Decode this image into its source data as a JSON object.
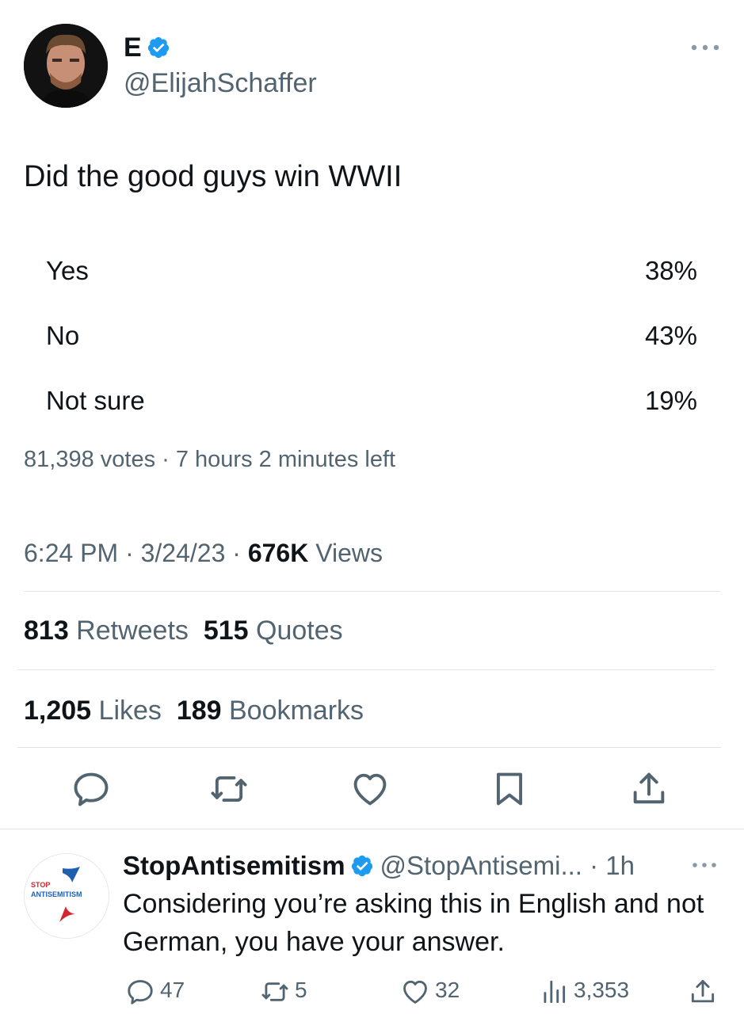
{
  "tweet": {
    "author_name": "E",
    "author_handle": "@ElijahSchaffer",
    "text": "Did the good guys win WWII",
    "poll": {
      "options": [
        {
          "label": "Yes",
          "percent": "38%"
        },
        {
          "label": "No",
          "percent": "43%"
        },
        {
          "label": "Not sure",
          "percent": "19%"
        }
      ],
      "meta": "81,398 votes · 7 hours 2 minutes left"
    },
    "timestamp": "6:24 PM · 3/24/23 · ",
    "views_count": "676K",
    "views_label": " Views",
    "stats": {
      "retweets_count": "813",
      "retweets_label": " Retweets",
      "quotes_count": "515",
      "quotes_label": " Quotes",
      "likes_count": "1,205",
      "likes_label": " Likes",
      "bookmarks_count": "189",
      "bookmarks_label": " Bookmarks"
    },
    "actions": [
      "reply-icon",
      "retweet-icon",
      "like-icon",
      "bookmark-icon",
      "share-icon"
    ]
  },
  "reply": {
    "author_name": "StopAntisemitism",
    "author_handle": "@StopAntisemi...",
    "time": " · 1h",
    "avatar_text_top": "STOP",
    "avatar_text_bottom": "ANTISEMITISM",
    "text": "Considering you’re asking this in English and not German, you have your answer.",
    "replies": "47",
    "retweets": "5",
    "likes": "32",
    "views": "3,353"
  },
  "colors": {
    "text": "#0f1419",
    "secondary": "#536471",
    "verified": "#1d9bf0",
    "divider": "#dfe3e6",
    "logo_blue": "#1f5fb0",
    "logo_red": "#d3262e"
  }
}
